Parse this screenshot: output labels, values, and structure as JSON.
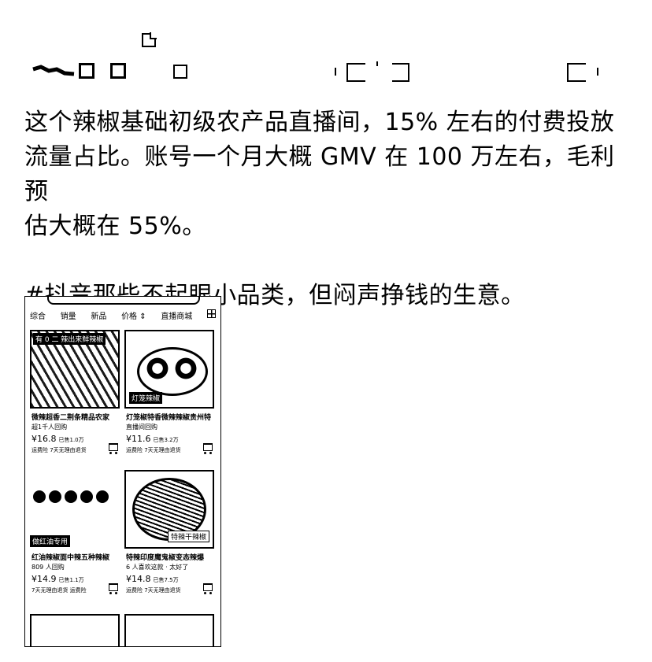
{
  "post": {
    "lines": [
      "这个辣椒基础初级农产品直播间，15% 左右的付费投放",
      "流量占比。账号一个月大概 GMV 在 100 万左右，毛利预",
      "估大概在 55%。"
    ],
    "hashtag": "#抖音那些不起眼小品类，但闷声挣钱的生意。"
  },
  "screenshot": {
    "tabs": [
      "综合",
      "销量",
      "新品",
      "价格 ⇕",
      "直播商城"
    ],
    "products": [
      {
        "banner": "有 0 二 辣出来鲜辣椒",
        "name": "微辣超香二荆条精品农家",
        "sub": "超1千人回购",
        "price": "¥16.8",
        "price_note": "已售1.0万",
        "meta": "运费险   7天无理由退货"
      },
      {
        "banner": "灯笼辣椒",
        "name": "灯笼椒特香微辣辣椒贵州特",
        "sub": "直播间回购",
        "price": "¥11.6",
        "price_note": "已售3.2万",
        "meta": "运费险   7天无理由退货"
      },
      {
        "banner": "做红油专用",
        "name": "红油辣椒面中辣五种辣椒",
        "sub": "809 人回购",
        "price": "¥14.9",
        "price_note": "已售1.1万",
        "meta": "7天无理由退货   运费险"
      },
      {
        "banner": "特辣干辣椒",
        "name": "特辣印度魔鬼椒变态辣爆",
        "sub": "6 人喜欢这款 · 太好了",
        "price": "¥14.8",
        "price_note": "已售7.5万",
        "meta": "运费险   7天无理由退货"
      }
    ]
  }
}
